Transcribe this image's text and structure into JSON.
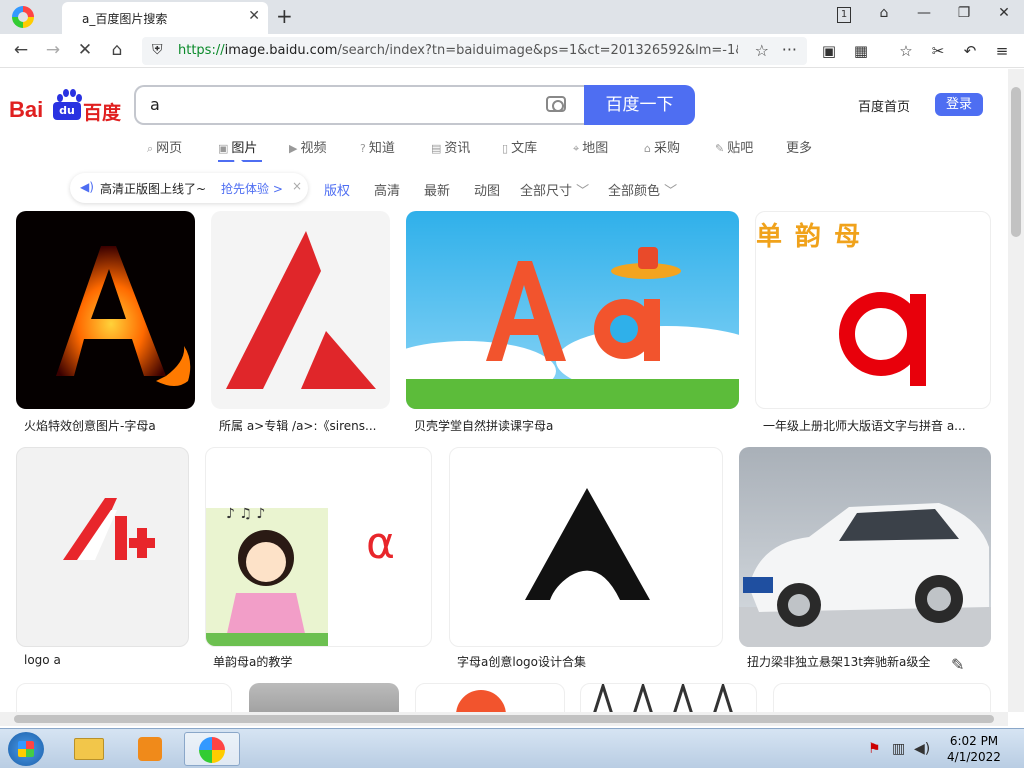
{
  "browser": {
    "tab_title": "a_百度图片搜索",
    "tab_count": "1",
    "url_proto": "https://",
    "url_host": "image.baidu.com",
    "url_rest": "/search/index?tn=baiduimage&ps=1&ct=201326592&lm=-1&cl=2"
  },
  "header": {
    "logo_latin": "Bai",
    "logo_du": "du",
    "logo_cn": "百度",
    "search_value": "a",
    "search_button": "百度一下",
    "home_link": "百度首页",
    "login_button": "登录"
  },
  "categories": [
    {
      "label": "网页",
      "icon": "search-icon"
    },
    {
      "label": "图片",
      "icon": "image-icon"
    },
    {
      "label": "视频",
      "icon": "video-icon"
    },
    {
      "label": "知道",
      "icon": "question-icon"
    },
    {
      "label": "资讯",
      "icon": "news-icon"
    },
    {
      "label": "文库",
      "icon": "document-icon"
    },
    {
      "label": "地图",
      "icon": "map-icon"
    },
    {
      "label": "采购",
      "icon": "purchase-icon"
    },
    {
      "label": "贴吧",
      "icon": "forum-icon"
    },
    {
      "label": "更多",
      "icon": ""
    }
  ],
  "notice": {
    "text": "高清正版图上线了~",
    "link": "抢先体验 >",
    "close": "×"
  },
  "filters": [
    "版权",
    "高清",
    "最新",
    "动图",
    "全部尺寸",
    "全部颜色"
  ],
  "results": [
    {
      "caption": "火焰特效创意图片-字母a",
      "img": "flame-letter-a-image"
    },
    {
      "caption": "所属 a>专辑 /a>:《sirens...",
      "img": "red-a-logo-image"
    },
    {
      "caption": "贝壳学堂自然拼读课字母a",
      "img": "cartoon-aa-image"
    },
    {
      "caption": "一年级上册北师大版语文字与拼音 a...",
      "img": "pinyin-a-image",
      "banner": "单 韵 母"
    },
    {
      "caption": "logo a",
      "img": "red-a-plus-logo-image"
    },
    {
      "caption": "单韵母a的教学",
      "img": "girl-singing-a-image",
      "letter": "α"
    },
    {
      "caption": "字母a创意logo设计合集",
      "img": "black-a-logo-image"
    },
    {
      "caption": "扭力梁非独立悬架13t奔驰新a级全",
      "img": "white-car-image"
    }
  ],
  "taskbar": {
    "time": "6:02 PM",
    "date": "4/1/2022"
  },
  "colors": {
    "accent": "#4e6ef2",
    "baidu_red": "#e02020",
    "baidu_blue": "#2932e1"
  }
}
